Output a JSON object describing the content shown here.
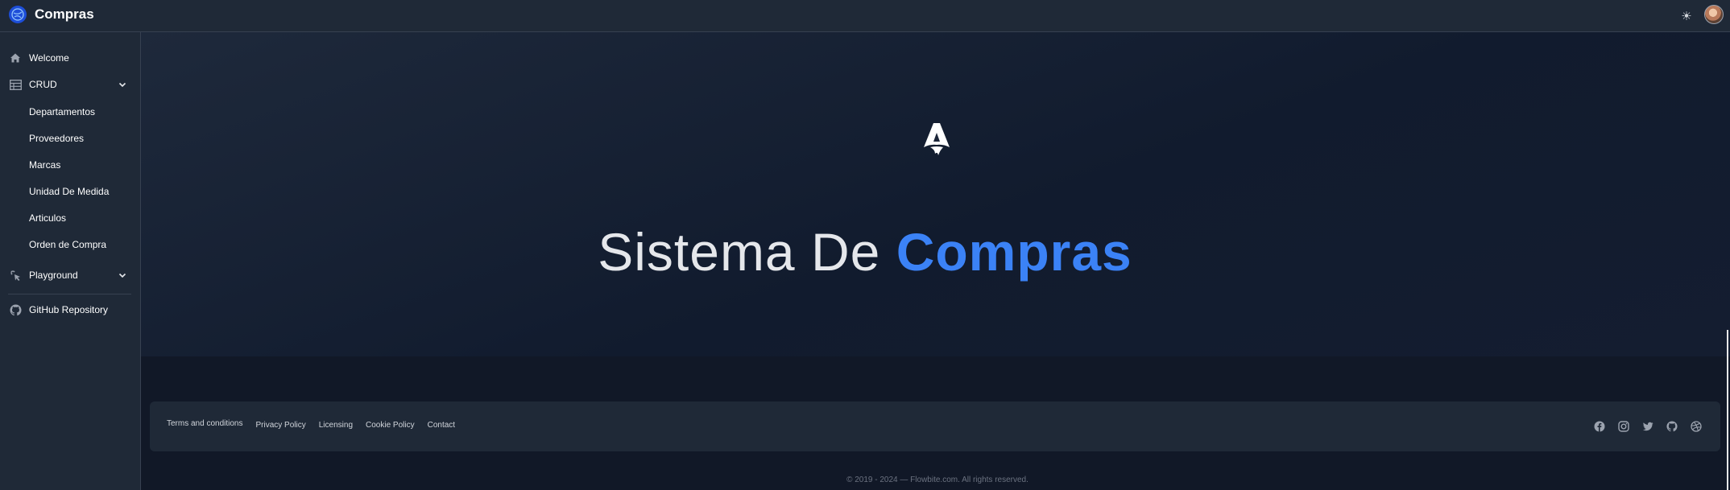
{
  "app": {
    "title": "Compras"
  },
  "navbar": {
    "logo_icon": "globe-logo-icon",
    "theme_toggle_icon": "sun-icon",
    "avatar_icon": "user-avatar"
  },
  "sidebar": {
    "items": [
      {
        "label": "Welcome",
        "icon": "home-icon"
      },
      {
        "label": "CRUD",
        "icon": "table-icon",
        "expanded": true
      },
      {
        "label": "Departamentos"
      },
      {
        "label": "Proveedores"
      },
      {
        "label": "Marcas"
      },
      {
        "label": "Unidad De Medida"
      },
      {
        "label": "Articulos"
      },
      {
        "label": "Orden de Compra"
      },
      {
        "label": "Playground",
        "icon": "cursor-click-icon",
        "expanded": false
      },
      {
        "label": "GitHub Repository",
        "icon": "github-icon"
      }
    ]
  },
  "hero": {
    "title_plain": "Sistema De ",
    "title_accent": "Compras",
    "logo_icon": "astro-rocket-icon"
  },
  "footer": {
    "links": [
      "Terms and conditions",
      "Privacy Policy",
      "Licensing",
      "Cookie Policy",
      "Contact"
    ],
    "social_icons": [
      "facebook-icon",
      "instagram-icon",
      "twitter-icon",
      "github-icon",
      "dribbble-icon"
    ],
    "copyright": "© 2019 - 2024 — Flowbite.com. All rights reserved."
  },
  "colors": {
    "background": "#111827",
    "panel": "#1f2937",
    "accent": "#3b82f6"
  }
}
